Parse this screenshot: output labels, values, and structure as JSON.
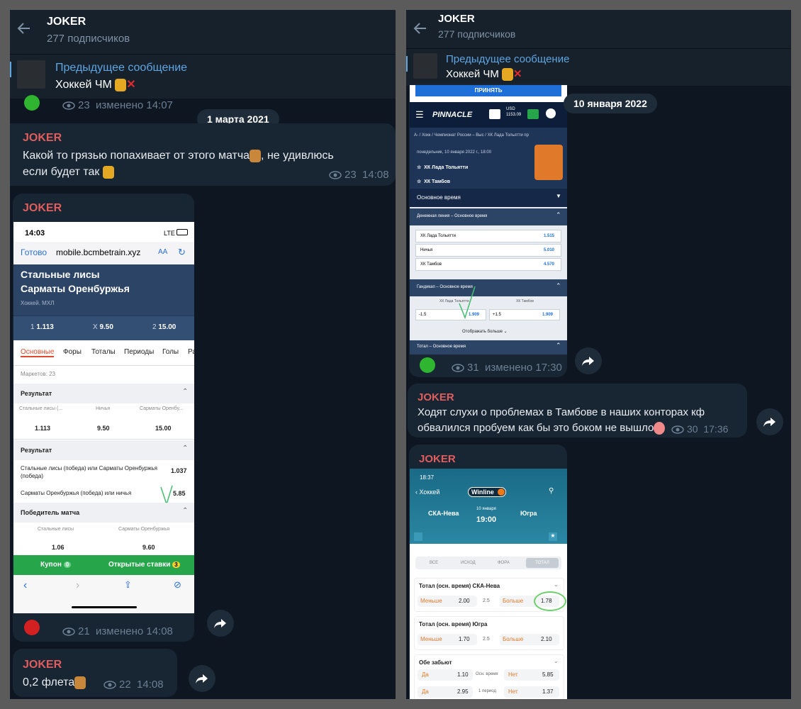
{
  "left": {
    "header": {
      "title": "JOKER",
      "subtitle": "277 подписчиков"
    },
    "pinned": {
      "title": "Предыдущее сообщение",
      "text": "Хоккей ЧМ"
    },
    "top_meta": {
      "views": "23",
      "edited": "изменено 14:07"
    },
    "date_pill": "1 марта 2021",
    "msg1": {
      "author": "JOKER",
      "line1": "Какой то грязью попахивает от этого матча",
      "line1_tail": ", не удивлюсь",
      "line2": "если будет так",
      "views": "23",
      "time": "14:08"
    },
    "msg2": {
      "author": "JOKER",
      "shot": {
        "status_time": "14:03",
        "status_right": "LTE",
        "done": "Готово",
        "url": "mobile.bcmbetrain.xyz",
        "aa": "AA",
        "team1": "Стальные лисы",
        "team2": "Сарматы Оренбуржья",
        "league": "Хоккей. МХЛ",
        "odds": [
          {
            "k": "1",
            "v": "1.113"
          },
          {
            "k": "X",
            "v": "9.50"
          },
          {
            "k": "2",
            "v": "15.00"
          }
        ],
        "tabs": [
          "Основные",
          "Форы",
          "Тоталы",
          "Периоды",
          "Голы",
          "Ра"
        ],
        "markets": "Маркетов: 23",
        "sec1": "Результат",
        "sec1_cols": [
          "Стальные лисы (...",
          "Ничья",
          "Сарматы Оренбу..."
        ],
        "sec1_vals": [
          "1.113",
          "9.50",
          "15.00"
        ],
        "sec2": "Результат",
        "row1_label": "Стальные лисы (победа) или Сарматы Оренбуржья (победа)",
        "row1_val": "1.037",
        "row2_label": "Сарматы Оренбуржья (победа) или ничья",
        "row2_val": "5.85",
        "sec3": "Победитель матча",
        "sec3_cols": [
          "Стальные лисы",
          "Сарматы Оренбуржья"
        ],
        "sec3_vals": [
          "1.06",
          "9.60"
        ],
        "coupon": "Купон",
        "coupon_count": "0",
        "open_bets": "Открытые ставки",
        "open_count": "3"
      },
      "views": "21",
      "edited": "изменено 14:08",
      "dot_color": "#d32020"
    },
    "msg3": {
      "author": "JOKER",
      "text": "0,2 флета",
      "views": "22",
      "time": "14:08"
    }
  },
  "right": {
    "header": {
      "title": "JOKER",
      "subtitle": "277 подписчиков"
    },
    "pinned": {
      "title": "Предыдущее сообщение",
      "text": "Хоккей ЧМ"
    },
    "date_pill": "10 января 2022",
    "shot1": {
      "accept": "ПРИНЯТЬ",
      "brand": "PINNACLE",
      "balance_cur": "USD",
      "balance": "1153.09",
      "crumbs": "А-  /  Хокк  /  Чемпионат России – Выс  /  ХК Лада Тольятти пр",
      "datetime": "понедельник, 10 января 2022 г., 18:00",
      "team1": "ХК Лада Тольятти",
      "team2": "ХК Тамбов",
      "period": "Основное время",
      "money_title": "Денежная линия – Основное время",
      "money": [
        {
          "k": "ХК Лада Тольятти",
          "v": "1.515"
        },
        {
          "k": "Ничья",
          "v": "5.010"
        },
        {
          "k": "ХК Тамбов",
          "v": "4.570"
        }
      ],
      "hcp_title": "Гандикап – Основное время",
      "hcp_cols": [
        "ХК Лада Тольятти",
        "ХК Тамбов"
      ],
      "hcp": [
        {
          "k": "-1.5",
          "v": "1.909"
        },
        {
          "k": "+1.5",
          "v": "1.909"
        }
      ],
      "more": "Отображать больше",
      "total_title": "Тотал – Основное время"
    },
    "shot1_meta": {
      "views": "31",
      "edited": "изменено 17:30",
      "dot_color": "#2fb52f"
    },
    "msg2": {
      "author": "JOKER",
      "line1": "Ходят слухи о проблемах в Тамбове в наших конторах кф",
      "line2": "обвалился пробуем как бы это боком не вышло",
      "views": "30",
      "time": "17:36"
    },
    "msg3": {
      "author": "JOKER",
      "shot": {
        "status_time": "18:37",
        "back": "Хоккей",
        "brand": "Winline",
        "team1": "СКА-Нева",
        "team2": "Югра",
        "date": "10 января",
        "time": "19:00",
        "filters": [
          "ВСЕ",
          "ИСХОД",
          "ФОРА",
          "ТОТАЛ"
        ],
        "t1_title": "Тотал (осн. время) СКА-Нева",
        "t1": {
          "less": "Меньше",
          "less_v": "2.00",
          "line": "2.5",
          "more": "Больше",
          "more_v": "1.78"
        },
        "t2_title": "Тотал (осн. время) Югра",
        "t2": {
          "less": "Меньше",
          "less_v": "1.70",
          "line": "2.5",
          "more": "Больше",
          "more_v": "2.10"
        },
        "both_title": "Обе забьют",
        "both1": {
          "yes": "Да",
          "yes_v": "1.10",
          "mid": "Осн. время",
          "no": "Нет",
          "no_v": "5.85"
        },
        "both2": {
          "yes": "Да",
          "yes_v": "2.95",
          "mid": "1 период",
          "no": "Нет",
          "no_v": "1.37"
        }
      }
    }
  }
}
